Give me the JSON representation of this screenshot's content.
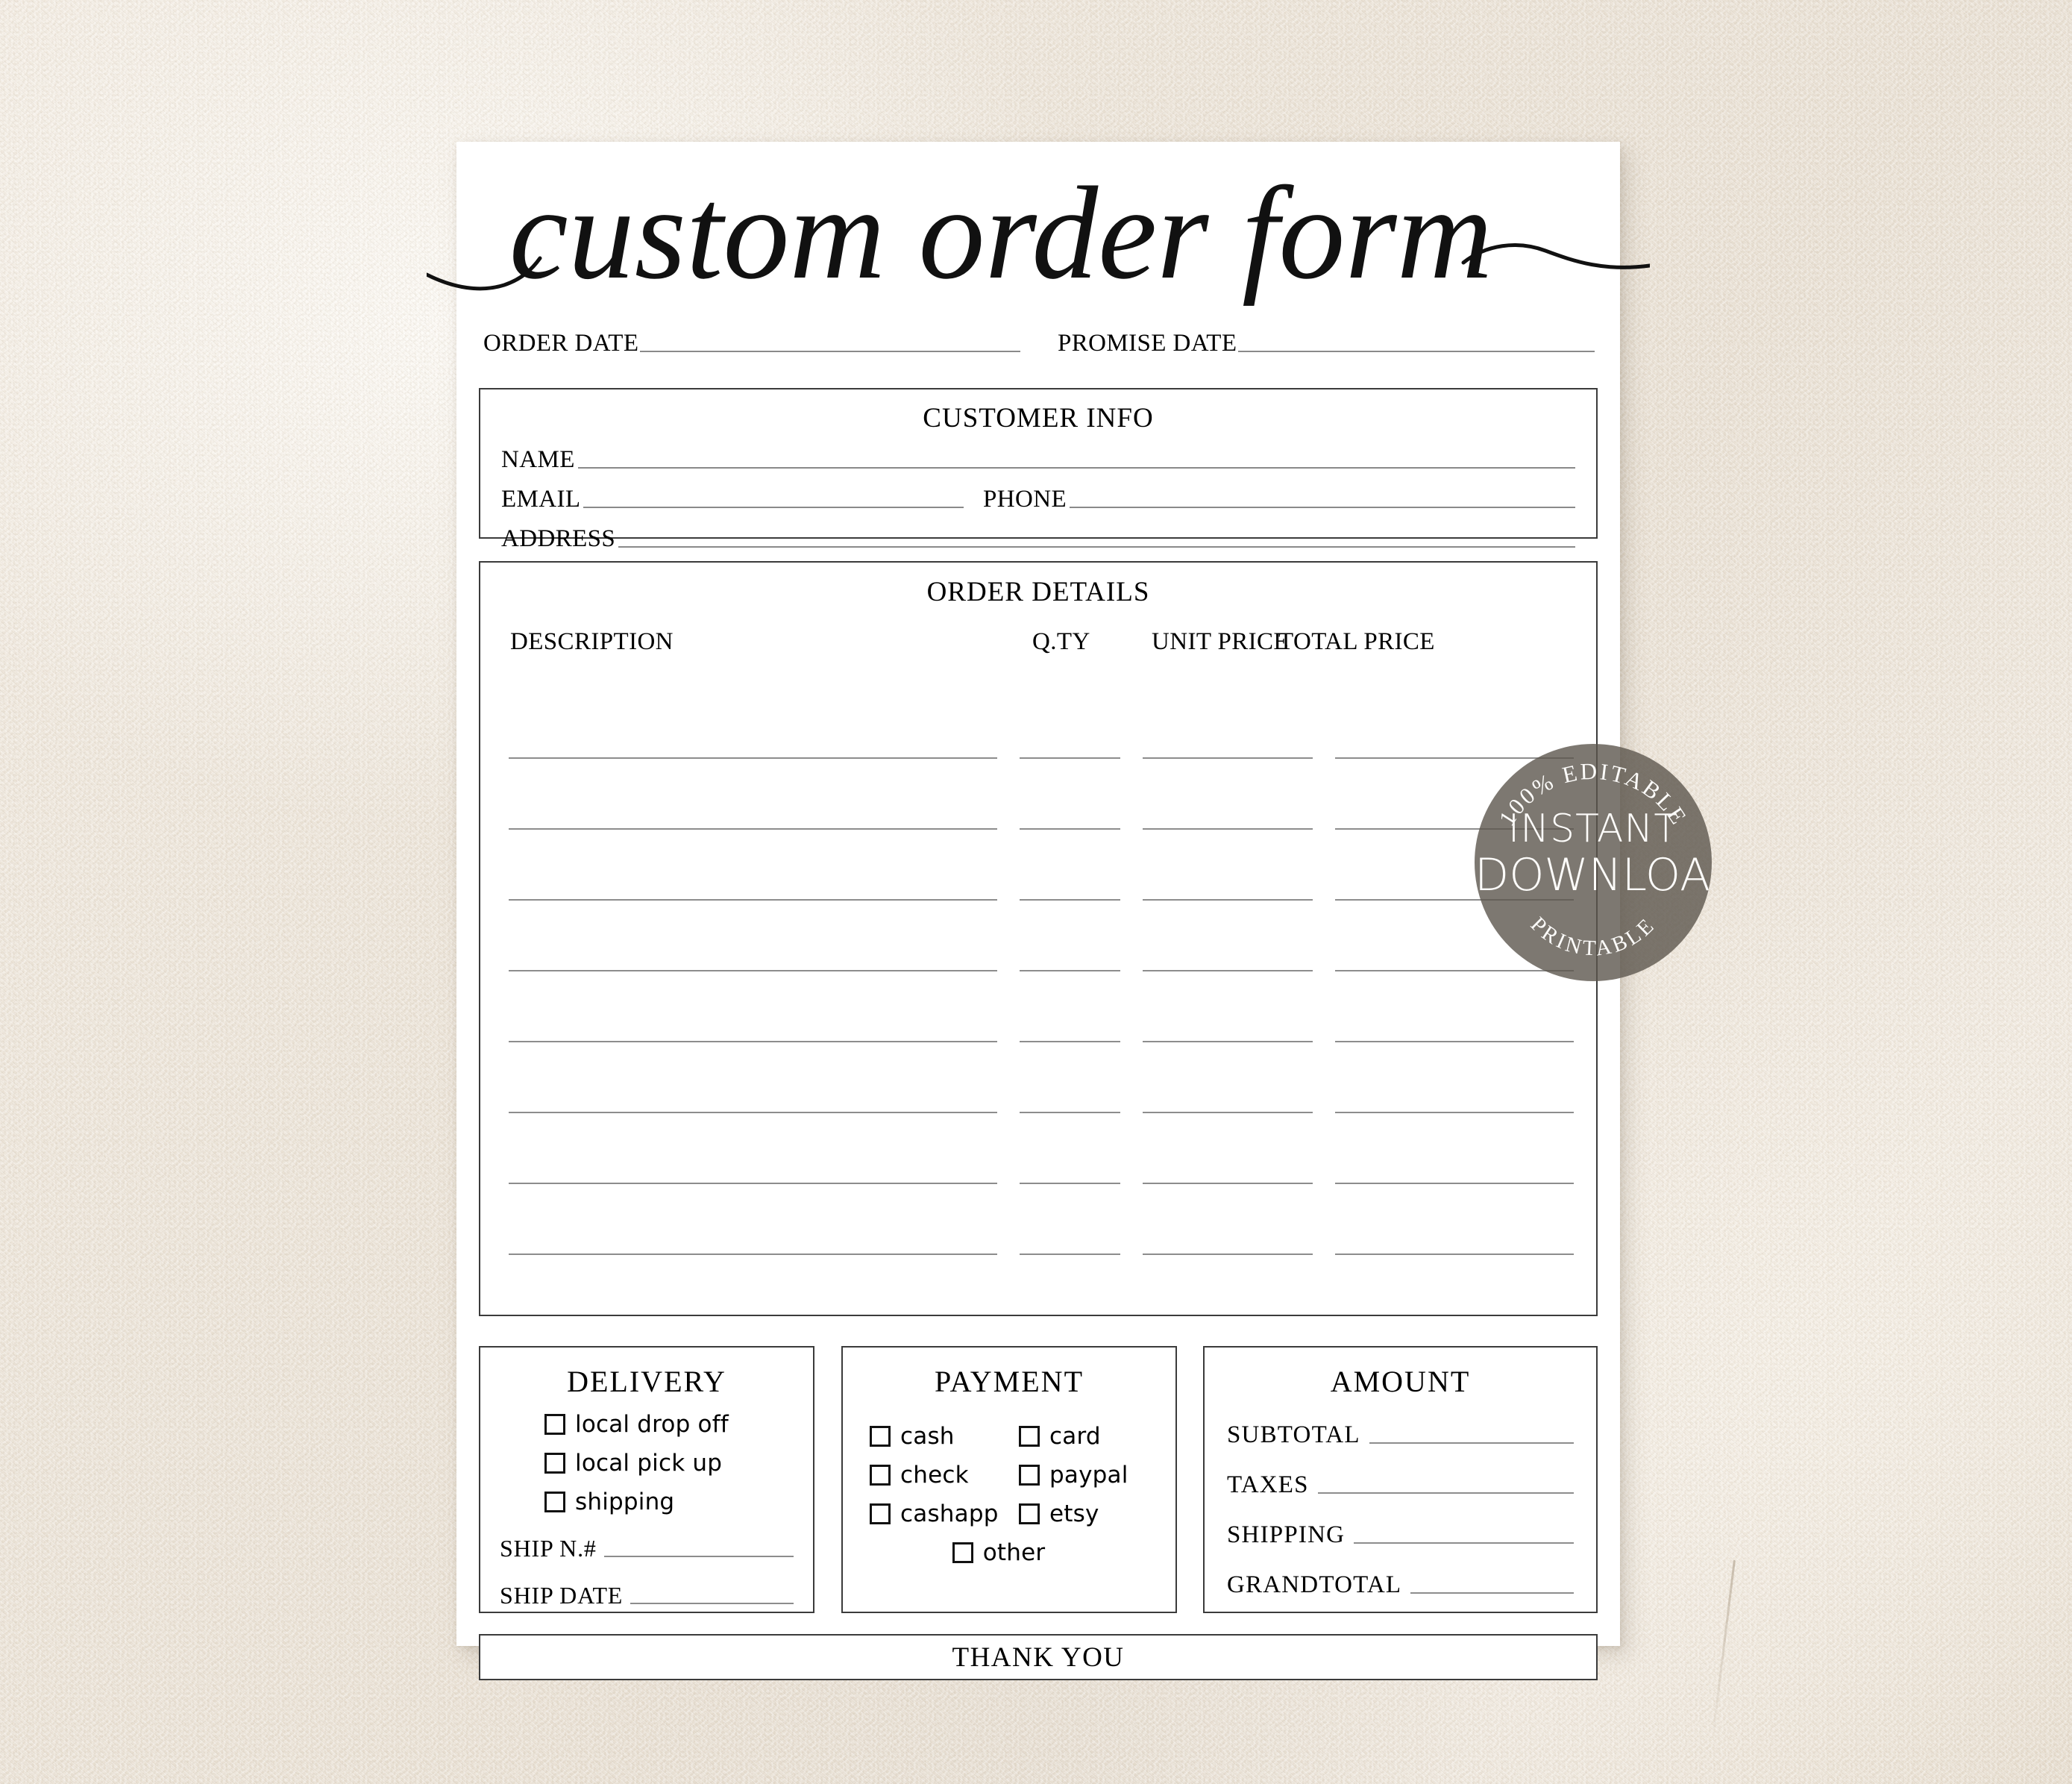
{
  "page": {
    "title": "custom order form",
    "background_color": "#ece4d8",
    "paper_color": "#ffffff",
    "ink_color": "#1a1a1a",
    "rule_color": "#8d8d8d"
  },
  "header": {
    "order_date_label": "ORDER DATE",
    "order_date_value": "",
    "promise_date_label": "PROMISE DATE",
    "promise_date_value": ""
  },
  "customer_info": {
    "title": "CUSTOMER INFO",
    "name_label": "NAME",
    "name_value": "",
    "email_label": "EMAIL",
    "email_value": "",
    "phone_label": "PHONE",
    "phone_value": "",
    "address_label": "ADDRESS",
    "address_value": ""
  },
  "order_details": {
    "title": "ORDER DETAILS",
    "columns": [
      "DESCRIPTION",
      "Q.TY",
      "UNIT PRICE",
      "TOTAL PRICE"
    ],
    "rows": [
      {
        "description": "",
        "qty": "",
        "unit_price": "",
        "total_price": ""
      },
      {
        "description": "",
        "qty": "",
        "unit_price": "",
        "total_price": ""
      },
      {
        "description": "",
        "qty": "",
        "unit_price": "",
        "total_price": ""
      },
      {
        "description": "",
        "qty": "",
        "unit_price": "",
        "total_price": ""
      },
      {
        "description": "",
        "qty": "",
        "unit_price": "",
        "total_price": ""
      },
      {
        "description": "",
        "qty": "",
        "unit_price": "",
        "total_price": ""
      },
      {
        "description": "",
        "qty": "",
        "unit_price": "",
        "total_price": ""
      },
      {
        "description": "",
        "qty": "",
        "unit_price": "",
        "total_price": ""
      }
    ],
    "row_count": 8
  },
  "delivery": {
    "title": "DELIVERY",
    "options": [
      {
        "label": "local drop off",
        "checked": false
      },
      {
        "label": "local pick up",
        "checked": false
      },
      {
        "label": "shipping",
        "checked": false
      }
    ],
    "ship_number_label": "SHIP N.#",
    "ship_number_value": "",
    "ship_date_label": "SHIP DATE",
    "ship_date_value": ""
  },
  "payment": {
    "title": "PAYMENT",
    "options_left": [
      {
        "label": "cash",
        "checked": false
      },
      {
        "label": "check",
        "checked": false
      },
      {
        "label": "cashapp",
        "checked": false
      }
    ],
    "options_right": [
      {
        "label": "card",
        "checked": false
      },
      {
        "label": "paypal",
        "checked": false
      },
      {
        "label": "etsy",
        "checked": false
      }
    ],
    "option_other": {
      "label": "other",
      "checked": false
    }
  },
  "amount": {
    "title": "AMOUNT",
    "lines": [
      {
        "label": "SUBTOTAL",
        "value": ""
      },
      {
        "label": "TAXES",
        "value": ""
      },
      {
        "label": "SHIPPING",
        "value": ""
      },
      {
        "label": "GRANDTOTAL",
        "value": ""
      }
    ]
  },
  "footer": {
    "thank_you": "THANK YOU"
  },
  "badge": {
    "arc_top": "100% EDITABLE",
    "line1": "INSTANT",
    "line2": "DOWNLOAD",
    "arc_bottom": "PRINTABLE",
    "fill_color": "#5c564e",
    "text_color": "#fdfcfa"
  }
}
